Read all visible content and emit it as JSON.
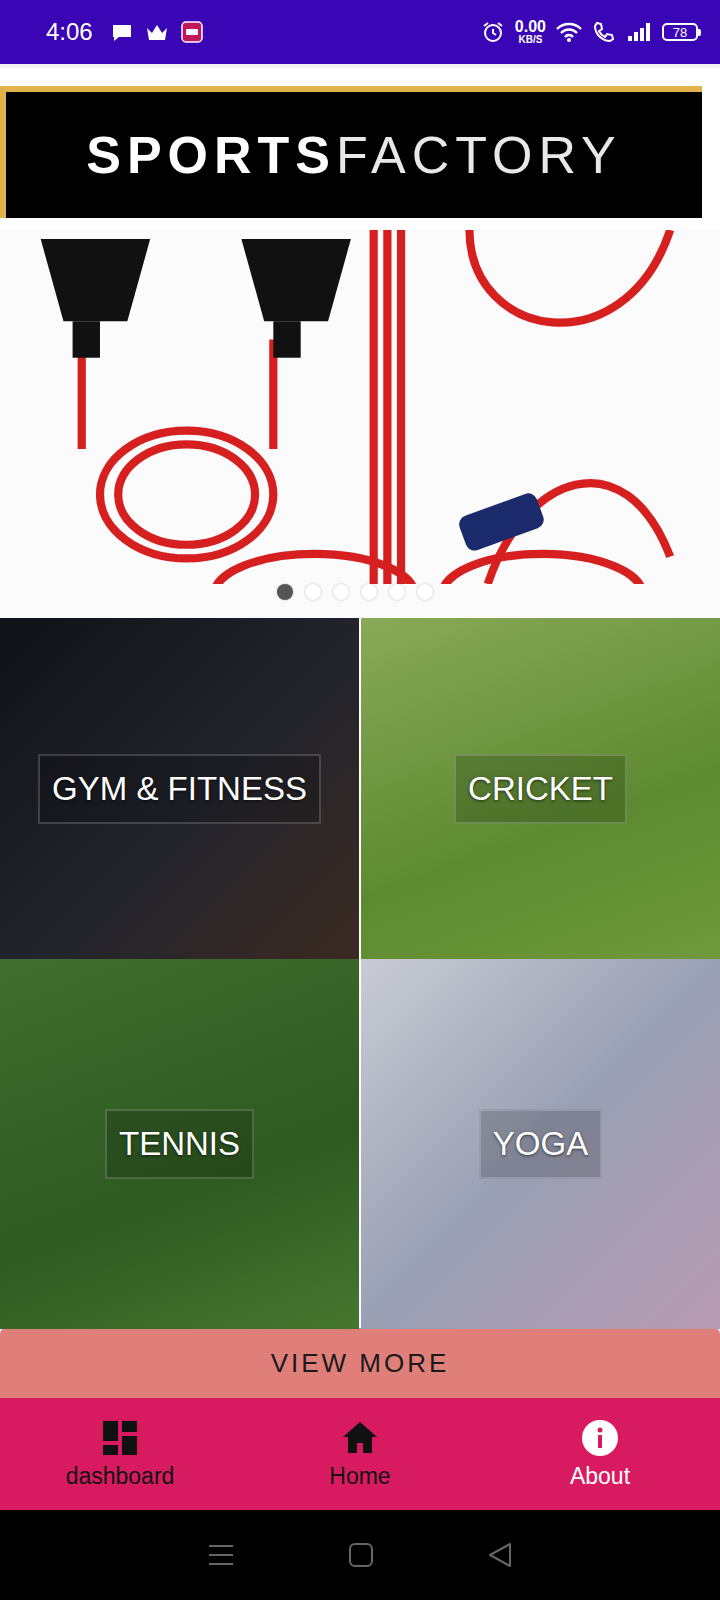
{
  "status_bar": {
    "time": "4:06",
    "net_speed": "0.00",
    "net_unit": "KB/S",
    "battery": "78"
  },
  "logo": {
    "bold": "SPORTS",
    "light": "FACTORY"
  },
  "carousel": {
    "dots": [
      {
        "selected": true
      },
      {
        "selected": false
      },
      {
        "selected": false
      },
      {
        "selected": false
      },
      {
        "selected": false
      },
      {
        "selected": false
      }
    ]
  },
  "categories": [
    {
      "label": "GYM & FITNESS"
    },
    {
      "label": "CRICKET"
    },
    {
      "label": "TENNIS"
    },
    {
      "label": "YOGA"
    }
  ],
  "view_more": "VIEW MORE",
  "bottom_nav": [
    {
      "label": "dashboard",
      "selected": false
    },
    {
      "label": "Home",
      "selected": false
    },
    {
      "label": "About",
      "selected": true
    }
  ]
}
